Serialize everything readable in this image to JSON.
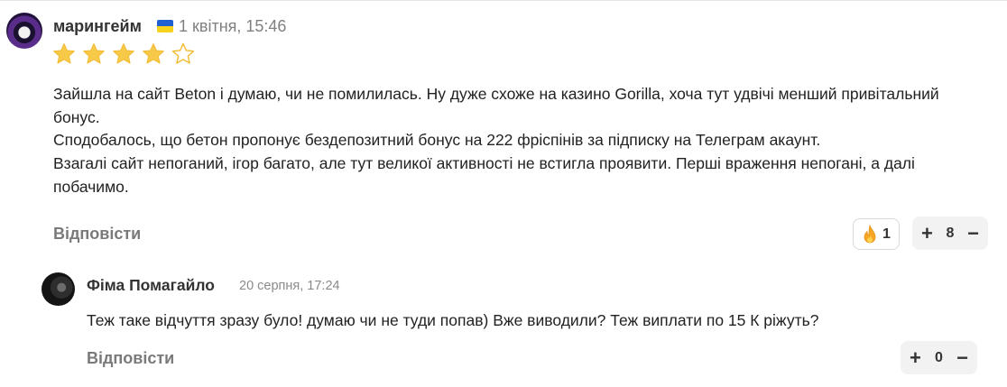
{
  "comment": {
    "author": "марингейм",
    "flag_colors": [
      "#1e5fd1",
      "#f7d21c"
    ],
    "date": "1 квітня, 15:46",
    "rating": 4,
    "rating_max": 5,
    "star_color": "#f7c948",
    "paragraphs": [
      "Зайшла на сайт Beton і думаю, чи не помилилась. Ну дуже схоже на казино Gorilla, хоча тут удвічі менший привітальний бонус.",
      "Сподобалось, що бетон пропонує бездепозитний бонус на 222 фріспінів за підписку на Телеграм акаунт.",
      "Взагалі сайт непоганий, ігор багато, але тут великої активності не встигла проявити. Перші враження непогані, а далі побачимо."
    ],
    "reply_label": "Відповісти",
    "reaction": {
      "icon": "flame-icon",
      "count": "1"
    },
    "vote": {
      "plus": "+",
      "minus": "−",
      "count": "8"
    }
  },
  "reply": {
    "author": "Фіма Помагайло",
    "date": "20 серпня, 17:24",
    "text": "Теж таке відчуття зразу було! думаю чи не туди попав) Вже виводили? Теж виплати по 15 К ріжуть?",
    "reply_label": "Відповісти",
    "vote": {
      "plus": "+",
      "minus": "−",
      "count": "0"
    }
  }
}
